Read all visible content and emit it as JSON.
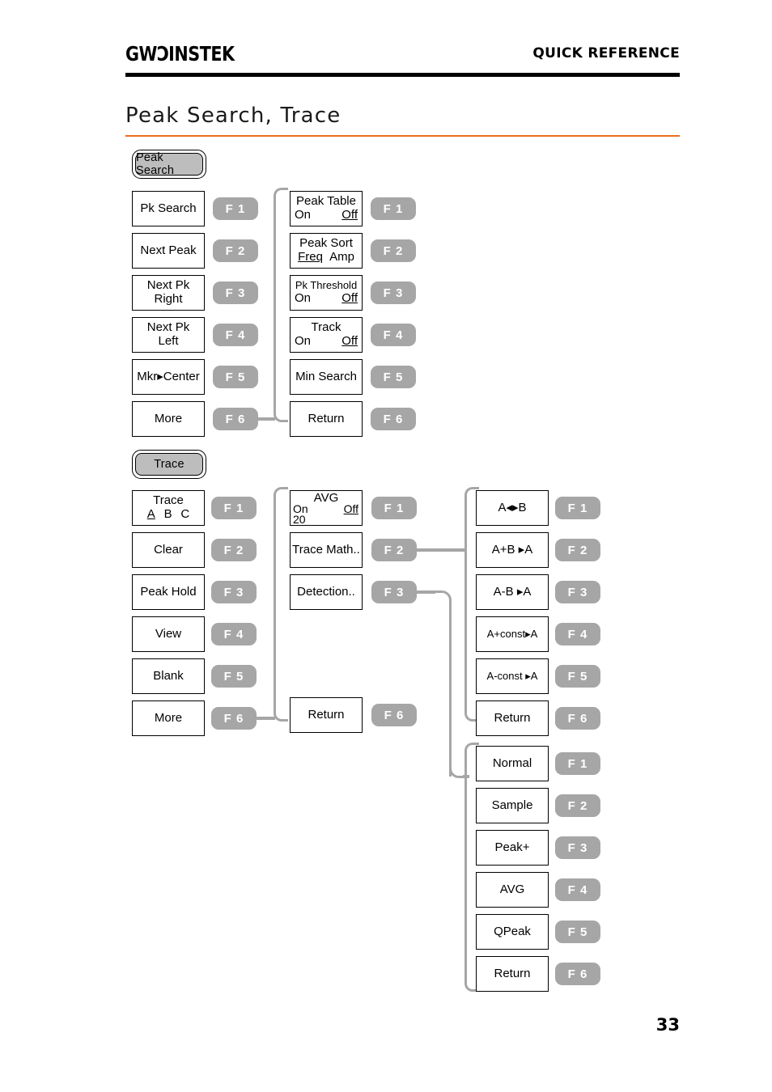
{
  "header": {
    "brand_gw": "GW",
    "brand_mark": "Ↄ",
    "brand_instek": "INSTEK",
    "title": "QUICK REFERENCE"
  },
  "section": {
    "title": "Peak Search, Trace",
    "accent_color": "#ef6c20"
  },
  "page": {
    "number": "33"
  },
  "fkeys": {
    "f1": "F 1",
    "f2": "F 2",
    "f3": "F 3",
    "f4": "F 4",
    "f5": "F 5",
    "f6": "F 6"
  },
  "peak_search": {
    "hardkey_label": "Peak Search",
    "level1": [
      {
        "label": "Pk Search",
        "fkey": "F 1"
      },
      {
        "label": "Next Peak",
        "fkey": "F 2"
      },
      {
        "line1": "Next Pk",
        "line2": "Right",
        "fkey": "F 3"
      },
      {
        "line1": "Next Pk",
        "line2": "Left",
        "fkey": "F 4"
      },
      {
        "label": "Mkr▸Center",
        "fkey": "F 5"
      },
      {
        "label": "More",
        "fkey": "F 6"
      }
    ],
    "level2": [
      {
        "title": "Peak Table",
        "opt_on": "On",
        "opt_off": "Off",
        "selected": "Off",
        "fkey": "F 1"
      },
      {
        "title": "Peak Sort",
        "opt_on": "Freq",
        "opt_off": "Amp",
        "selected": "Freq",
        "fkey": "F 2"
      },
      {
        "title": "Pk Threshold",
        "opt_on": "On",
        "opt_off": "Off",
        "selected": "Off",
        "fkey": "F 3"
      },
      {
        "title": "Track",
        "opt_on": "On",
        "opt_off": "Off",
        "selected": "Off",
        "fkey": "F 4"
      },
      {
        "label": "Min Search",
        "fkey": "F 5"
      },
      {
        "label": "Return",
        "fkey": "F 6"
      }
    ]
  },
  "trace": {
    "hardkey_label": "Trace",
    "level1": [
      {
        "title": "Trace",
        "opt_a": "A",
        "opt_b": "B",
        "opt_c": "C",
        "selected": "A",
        "fkey": "F 1"
      },
      {
        "label": "Clear",
        "fkey": "F 2"
      },
      {
        "label": "Peak Hold",
        "fkey": "F 3"
      },
      {
        "label": "View",
        "fkey": "F 4"
      },
      {
        "label": "Blank",
        "fkey": "F 5"
      },
      {
        "label": "More",
        "fkey": "F 6"
      }
    ],
    "level2": [
      {
        "title": "AVG",
        "opt_on": "On",
        "value": "20",
        "opt_off": "Off",
        "selected": "Off",
        "fkey": "F 1"
      },
      {
        "label": "Trace Math..",
        "fkey": "F 2"
      },
      {
        "label": "Detection..",
        "fkey": "F 3"
      },
      {
        "label": "Return",
        "fkey": "F 6"
      }
    ],
    "trace_math": [
      {
        "label": "A◂▸B",
        "fkey": "F 1"
      },
      {
        "label": "A+B ▸A",
        "fkey": "F 2"
      },
      {
        "label": "A-B ▸A",
        "fkey": "F 3"
      },
      {
        "label": "A+const▸A",
        "fkey": "F 4"
      },
      {
        "label": "A-const ▸A",
        "fkey": "F 5"
      },
      {
        "label": "Return",
        "fkey": "F 6"
      }
    ],
    "detection": [
      {
        "label": "Normal",
        "fkey": "F 1"
      },
      {
        "label": "Sample",
        "fkey": "F 2"
      },
      {
        "label": "Peak+",
        "fkey": "F 3"
      },
      {
        "label": "AVG",
        "fkey": "F 4"
      },
      {
        "label": "QPeak",
        "fkey": "F 5"
      },
      {
        "label": "Return",
        "fkey": "F 6"
      }
    ]
  }
}
